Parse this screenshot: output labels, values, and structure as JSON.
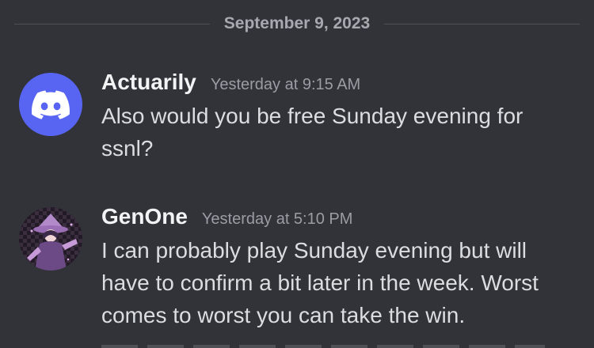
{
  "date_divider": "September 9, 2023",
  "messages": [
    {
      "username": "Actuarily",
      "timestamp": "Yesterday at 9:15 AM",
      "text": "Also would you be free Sunday evening for ssnl?",
      "avatar_icon": "discord-logo-icon",
      "avatar_color": "#5865f2"
    },
    {
      "username": "GenOne",
      "timestamp": "Yesterday at 5:10 PM",
      "text": "I can probably play Sunday evening but will have to confirm a bit later in the week. Worst comes to worst you can take the win.",
      "avatar_icon": "anime-character-avatar-icon"
    }
  ],
  "colors": {
    "background": "#313338",
    "username": "#f2f3f5",
    "timestamp": "#9a9da4",
    "message_text": "#dbdee1",
    "divider": "#4e5058",
    "discord_blurple": "#5865f2"
  }
}
